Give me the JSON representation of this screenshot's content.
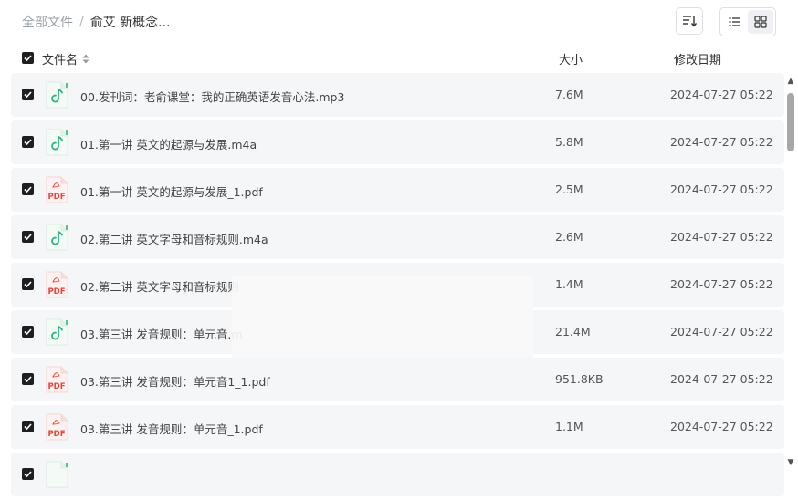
{
  "breadcrumb": {
    "root": "全部文件",
    "separator": "/",
    "current": "俞艾 新概念..."
  },
  "columns": {
    "name": "文件名",
    "size": "大小",
    "modified": "修改日期"
  },
  "files": [
    {
      "name": "00.发刊词：老俞课堂：我的正确英语发音心法.mp3",
      "size": "7.6M",
      "date": "2024-07-27 05:22",
      "type": "audio"
    },
    {
      "name": "01.第一讲 英文的起源与发展.m4a",
      "size": "5.8M",
      "date": "2024-07-27 05:22",
      "type": "audio"
    },
    {
      "name": "01.第一讲 英文的起源与发展_1.pdf",
      "size": "2.5M",
      "date": "2024-07-27 05:22",
      "type": "pdf"
    },
    {
      "name": "02.第二讲 英文字母和音标规则.m4a",
      "size": "2.6M",
      "date": "2024-07-27 05:22",
      "type": "audio"
    },
    {
      "name": "02.第二讲 英文字母和音标规则",
      "size": "1.4M",
      "date": "2024-07-27 05:22",
      "type": "pdf"
    },
    {
      "name": "03.第三讲 发音规则：单元音.m",
      "size": "21.4M",
      "date": "2024-07-27 05:22",
      "type": "audio"
    },
    {
      "name": "03.第三讲 发音规则：单元音1_1.pdf",
      "size": "951.8KB",
      "date": "2024-07-27 05:22",
      "type": "pdf"
    },
    {
      "name": "03.第三讲 发音规则：单元音_1.pdf",
      "size": "1.1M",
      "date": "2024-07-27 05:22",
      "type": "pdf"
    },
    {
      "name": "",
      "size": "",
      "date": "",
      "type": "audio"
    }
  ],
  "icons": {
    "pdf_label": "PDF"
  },
  "colors": {
    "audio_green": "#2fb67a",
    "pdf_red": "#e8463a",
    "checkbox": "#1f1f1f"
  }
}
